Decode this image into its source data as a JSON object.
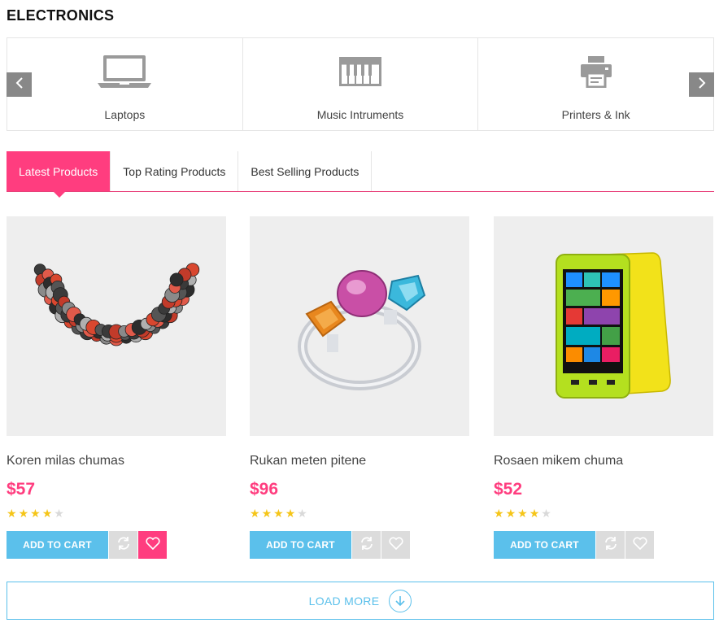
{
  "section": {
    "title": "ELECTRONICS"
  },
  "categories": [
    {
      "label": "Laptops",
      "icon": "laptop-icon"
    },
    {
      "label": "Music Intruments",
      "icon": "piano-keyboard-icon"
    },
    {
      "label": "Printers & Ink",
      "icon": "printer-icon"
    }
  ],
  "tabs": [
    {
      "label": "Latest Products",
      "active": true
    },
    {
      "label": "Top Rating Products",
      "active": false
    },
    {
      "label": "Best Selling Products",
      "active": false
    }
  ],
  "products": [
    {
      "name": "Koren milas chumas",
      "price": "$57",
      "rating": 4,
      "rating_max": 5,
      "image": "necklace",
      "wishlist_active": true
    },
    {
      "name": "Rukan meten pitene",
      "price": "$96",
      "rating": 4,
      "rating_max": 5,
      "image": "gem-ring",
      "wishlist_active": false
    },
    {
      "name": "Rosaen mikem chuma",
      "price": "$52",
      "rating": 4,
      "rating_max": 5,
      "image": "yellow-phone",
      "wishlist_active": false
    }
  ],
  "buttons": {
    "add_to_cart": "ADD TO CART",
    "load_more": "LOAD MORE"
  },
  "colors": {
    "accent_pink": "#ff3d7f",
    "accent_blue": "#5bc0eb",
    "star": "#f5c518",
    "arrow_bg": "#888888"
  }
}
